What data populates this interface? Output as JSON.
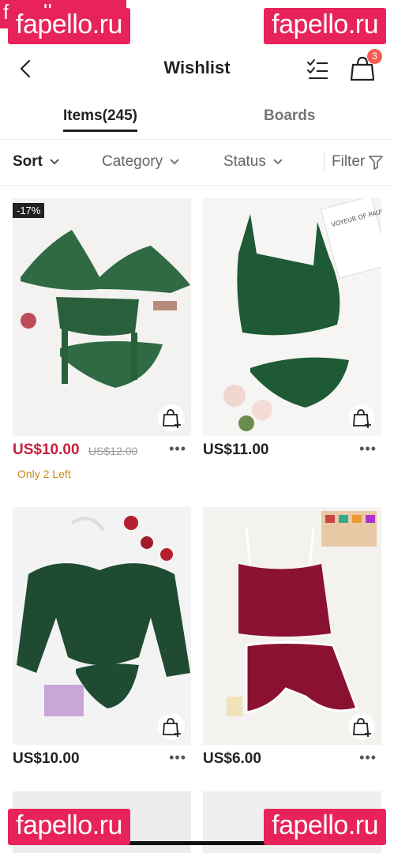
{
  "watermark": "fapello.ru",
  "header": {
    "title": "Wishlist",
    "cart_count": "3"
  },
  "tabs": [
    {
      "label": "Items(245)",
      "active": true
    },
    {
      "label": "Boards",
      "active": false
    }
  ],
  "filters": {
    "sort": "Sort",
    "category": "Category",
    "status": "Status",
    "filter": "Filter"
  },
  "products": [
    {
      "price": "US$10.00",
      "original_price": "US$12.00",
      "discount": "-17%",
      "stock_note": "Only 2 Left",
      "image_color": "#2f6a43"
    },
    {
      "price": "US$11.00",
      "image_color": "#1e5a35",
      "image_text": "VOYEUR OF PAUL KOOIKE"
    },
    {
      "price": "US$10.00",
      "image_color": "#1f4b32"
    },
    {
      "price": "US$6.00",
      "image_color": "#8a1230"
    }
  ],
  "icons": [
    "back-icon",
    "checklist-icon",
    "shopping-bag-icon",
    "chevron-down-icon",
    "filter-icon",
    "add-to-bag-icon",
    "more-options-icon"
  ]
}
